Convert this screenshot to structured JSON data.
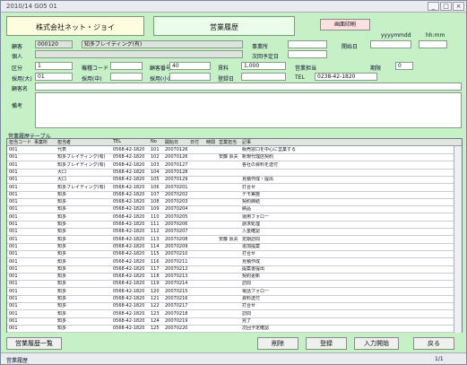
{
  "window": {
    "title": "2010/14 G05 01",
    "controls": [
      "_",
      "□",
      "×"
    ]
  },
  "company": "株式会社ネット・ジョイ",
  "form_title": "営業履歴",
  "print_button": "画面印刷",
  "date_hints": {
    "date": "yyyymmdd",
    "time": "hh:mm"
  },
  "labels": {
    "customer": "顧客",
    "person": "個人",
    "category": "区分",
    "equipment": "機種コード",
    "cust_no": "顧客番号",
    "rent": "賃料",
    "sales_staff": "営業担当",
    "start_date": "開始日",
    "business": "事業所",
    "cust_name": "顧客名",
    "tel": "TEL",
    "hire": "採用(大)",
    "hire2": "採用(中)",
    "hire3": "採用(小)",
    "area": "所属(大)",
    "area2": "所属(中)",
    "register": "登録日",
    "next": "次回予定日",
    "deadline": "期限",
    "memo": "備考",
    "grid_title": "営業履歴テーブル"
  },
  "fields": {
    "cust_code": "000120",
    "cust_name_val": "知多ブレイディング(有)",
    "kubun": "1",
    "sales_total": "40",
    "price": "1,000",
    "count": "0",
    "emp_code": "01",
    "tel_val": "0238-42-1820"
  },
  "columns": [
    "担当コード",
    "事業所",
    "担当者",
    "TEL",
    "No",
    "開始日",
    "日付",
    "時間",
    "営業担当",
    "記事"
  ],
  "rows": [
    [
      "001",
      "",
      "代表",
      "0568-42-1820",
      "101",
      "20070126",
      "",
      "",
      "",
      "販売窓口を中心に営業する"
    ],
    [
      "001",
      "",
      "知多ブレイディング(有)",
      "0568-42-1820",
      "102",
      "20070126",
      "",
      "",
      "安藤 辰夫",
      "新規代理店契約"
    ],
    [
      "001",
      "",
      "知多ブレイディング(有)",
      "0568-42-1820",
      "103",
      "20070127",
      "",
      "",
      "",
      "各社の資料を送付"
    ],
    [
      "001",
      "",
      "大口",
      "0568-42-1820",
      "104",
      "20070128",
      "",
      "",
      "",
      ""
    ],
    [
      "001",
      "",
      "大口",
      "0568-42-1820",
      "105",
      "20070129",
      "",
      "",
      "",
      "見積作成・提出"
    ],
    [
      "001",
      "",
      "知多ブレイディング(有)",
      "0568-42-1820",
      "106",
      "20070201",
      "",
      "",
      "",
      "打合せ"
    ],
    [
      "001",
      "",
      "知多",
      "0568-42-1820",
      "107",
      "20070202",
      "",
      "",
      "",
      "デモ実施"
    ],
    [
      "001",
      "",
      "知多",
      "0568-42-1820",
      "108",
      "20070203",
      "",
      "",
      "",
      "契約締結"
    ],
    [
      "001",
      "",
      "知多",
      "0568-42-1820",
      "109",
      "20070204",
      "",
      "",
      "",
      "納品"
    ],
    [
      "001",
      "",
      "知多",
      "0568-42-1820",
      "110",
      "20070205",
      "",
      "",
      "",
      "運用フォロー"
    ],
    [
      "001",
      "",
      "知多",
      "0568-42-1820",
      "111",
      "20070206",
      "",
      "",
      "",
      "請求処理"
    ],
    [
      "001",
      "",
      "知多",
      "0568-42-1820",
      "112",
      "20070207",
      "",
      "",
      "",
      "入金確認"
    ],
    [
      "001",
      "",
      "知多",
      "0568-42-1820",
      "113",
      "20070208",
      "",
      "",
      "安藤 辰夫",
      "定期訪問"
    ],
    [
      "001",
      "",
      "知多",
      "0568-42-1820",
      "114",
      "20070209",
      "",
      "",
      "",
      "追加提案"
    ],
    [
      "001",
      "",
      "知多",
      "0568-42-1820",
      "115",
      "20070210",
      "",
      "",
      "",
      "打合せ"
    ],
    [
      "001",
      "",
      "知多",
      "0568-42-1820",
      "116",
      "20070211",
      "",
      "",
      "",
      "見積作成"
    ],
    [
      "001",
      "",
      "知多",
      "0568-42-1820",
      "117",
      "20070212",
      "",
      "",
      "",
      "提案書提出"
    ],
    [
      "001",
      "",
      "知多",
      "0568-42-1820",
      "118",
      "20070213",
      "",
      "",
      "",
      "契約更新"
    ],
    [
      "001",
      "",
      "知多",
      "0568-42-1820",
      "119",
      "20070214",
      "",
      "",
      "",
      "訪問"
    ],
    [
      "001",
      "",
      "知多",
      "0568-42-1820",
      "120",
      "20070215",
      "",
      "",
      "",
      "電話フォロー"
    ],
    [
      "001",
      "",
      "知多",
      "0568-42-1820",
      "121",
      "20070216",
      "",
      "",
      "",
      "資料送付"
    ],
    [
      "001",
      "",
      "知多",
      "0568-42-1820",
      "122",
      "20070217",
      "",
      "",
      "",
      "打合せ"
    ],
    [
      "001",
      "",
      "知多",
      "0568-42-1820",
      "123",
      "20070218",
      "",
      "",
      "",
      "訪問"
    ],
    [
      "001",
      "",
      "知多",
      "0568-42-1820",
      "124",
      "20070219",
      "",
      "",
      "",
      "完了"
    ],
    [
      "001",
      "",
      "知多",
      "0568-42-1820",
      "125",
      "20070220",
      "",
      "",
      "",
      "次回予定確認"
    ]
  ],
  "buttons": {
    "list": "営業履歴一覧",
    "delete": "削除",
    "new": "登録",
    "input": "入力開始",
    "close": "戻る"
  },
  "status": {
    "text": "営業履歴",
    "pages": "1/1"
  }
}
